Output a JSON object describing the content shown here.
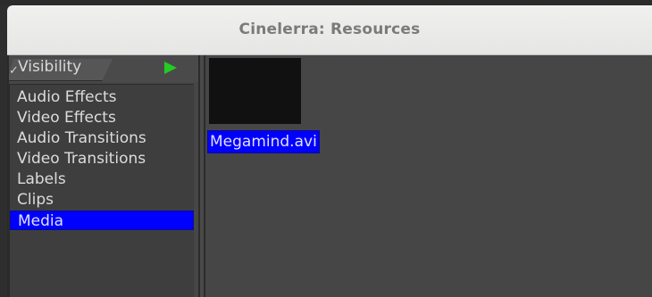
{
  "window": {
    "title": "Cinelerra: Resources"
  },
  "folders": {
    "header_label": "Visibility",
    "items": [
      {
        "label": "Audio Effects",
        "selected": false
      },
      {
        "label": "Video Effects",
        "selected": false
      },
      {
        "label": "Audio Transitions",
        "selected": false
      },
      {
        "label": "Video Transitions",
        "selected": false
      },
      {
        "label": "Labels",
        "selected": false
      },
      {
        "label": "Clips",
        "selected": false
      },
      {
        "label": "Media",
        "selected": true
      }
    ]
  },
  "resources": {
    "items": [
      {
        "label": "Megamind.avi",
        "selected": true
      }
    ]
  },
  "colors": {
    "selection": "#0000ff",
    "play_icon": "#22cc22",
    "panel_bg": "#464646"
  },
  "icons": {
    "play": "play-icon",
    "visibility_tick": "tick-icon"
  }
}
